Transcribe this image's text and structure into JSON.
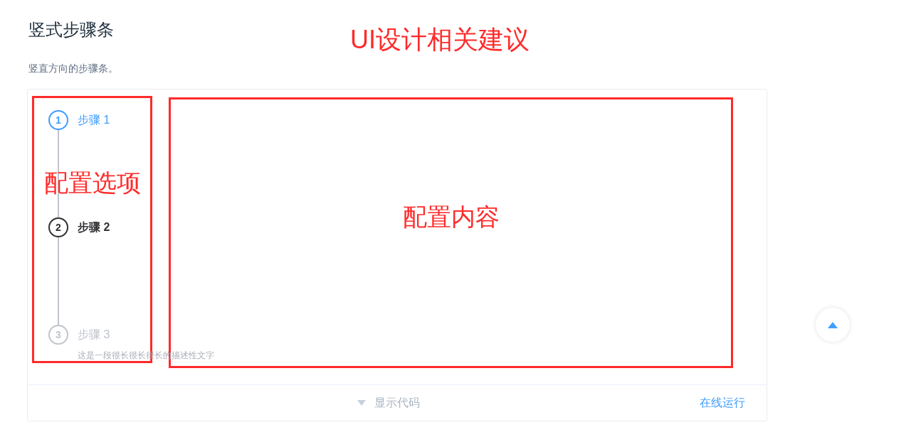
{
  "title": "竖式步骤条",
  "description": "竖直方向的步骤条。",
  "steps": [
    {
      "number": "1",
      "title": "步骤 1",
      "kind": "finish"
    },
    {
      "number": "2",
      "title": "步骤 2",
      "kind": "process"
    },
    {
      "number": "3",
      "title": "步骤 3",
      "kind": "wait",
      "description": "这是一段很长很长很长的描述性文字"
    }
  ],
  "footer": {
    "toggle_label": "显示代码",
    "run_link": "在线运行"
  },
  "annotations": {
    "heading": "UI设计相关建议",
    "boxes": [
      {
        "label": "配置选项"
      },
      {
        "label": "配置内容"
      }
    ]
  }
}
